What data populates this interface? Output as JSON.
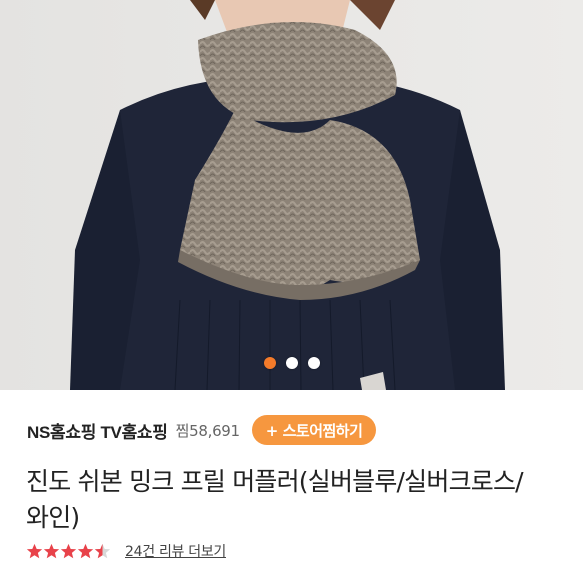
{
  "product_image": {
    "alt": ""
  },
  "carousel": {
    "total": 3,
    "active_index": 0,
    "active_color": "#f47b2a"
  },
  "store": {
    "name": "NS홈쇼핑 TV홈쇼핑",
    "zzim_count": "찜58,691",
    "follow_button": "+ 스토어찜하기",
    "button_color": "#f6973f"
  },
  "product": {
    "title": "진도 쉬본 밍크 프릴 머플러(실버블루/실버크로스/와인)"
  },
  "rating": {
    "stars": 4.5,
    "star_color": "#e8424a",
    "review_link": "24건 리뷰 더보기"
  }
}
